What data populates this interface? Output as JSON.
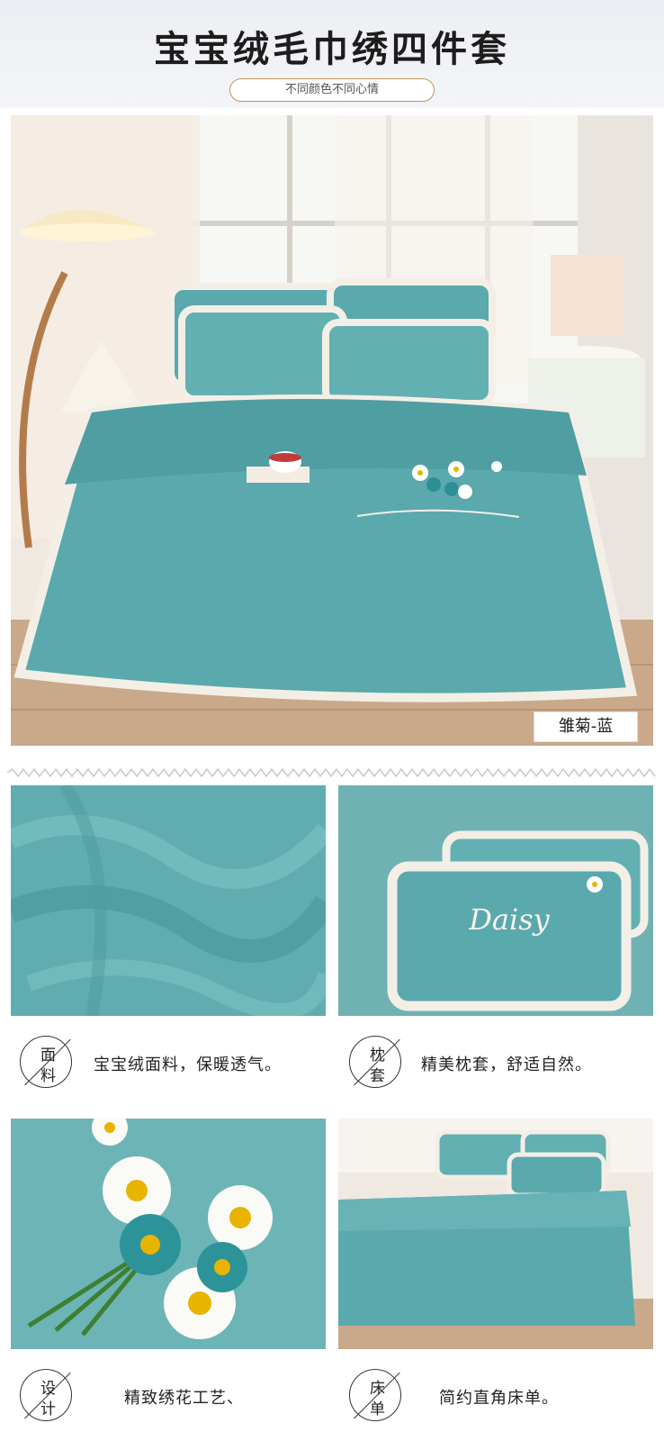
{
  "header": {
    "title": "宝宝绒毛巾绣四件套",
    "subtitle": "不同颜色不同心情"
  },
  "main_photo": {
    "color_label": "雏菊-蓝"
  },
  "features": [
    {
      "badge_char_1": "面",
      "badge_char_2": "料",
      "text": "宝宝绒面料，保暖透气。"
    },
    {
      "badge_char_1": "枕",
      "badge_char_2": "套",
      "text": "精美枕套，舒适自然。"
    },
    {
      "badge_char_1": "设",
      "badge_char_2": "计",
      "text": "精致绣花工艺、"
    },
    {
      "badge_char_1": "床",
      "badge_char_2": "单",
      "text": "简约直角床单。"
    }
  ],
  "colors": {
    "teal": "#5aa9ac",
    "teal_dark": "#3f8f93",
    "cream_fur": "#f3efe6",
    "badge_border": "#c8925a"
  }
}
